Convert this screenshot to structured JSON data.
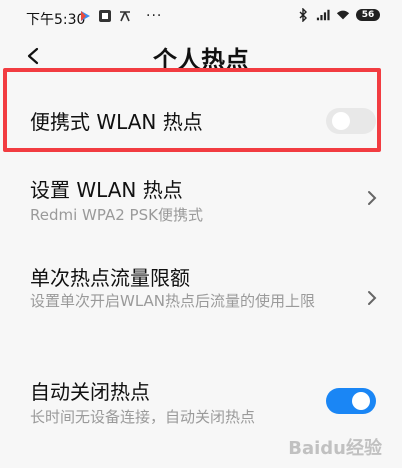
{
  "status_bar": {
    "time": "下午5:30",
    "dots": "···",
    "battery": "56",
    "icons": [
      "play-icon",
      "app-icon",
      "translate-icon",
      "bluetooth-icon",
      "cellular-signal-icon",
      "wifi-icon",
      "battery-icon"
    ]
  },
  "header": {
    "title": "个人热点",
    "back_icon": "back-arrow-icon"
  },
  "settings": [
    {
      "title": "便携式 WLAN 热点",
      "control": "toggle",
      "toggle_state": "off"
    },
    {
      "title": "设置 WLAN 热点",
      "subtitle": "Redmi WPA2 PSK便携式",
      "control": "chevron"
    },
    {
      "title": "单次热点流量限额",
      "subtitle": "设置单次开启WLAN热点后流量的使用上限",
      "control": "chevron"
    },
    {
      "title": "自动关闭热点",
      "subtitle": "长时间无设备连接，自动关闭热点",
      "control": "toggle",
      "toggle_state": "on"
    }
  ],
  "colors": {
    "highlight_border": "#f23c41",
    "toggle_on": "#1a86f5",
    "toggle_off": "#e8e8e8"
  },
  "watermark": "Baidu经验"
}
